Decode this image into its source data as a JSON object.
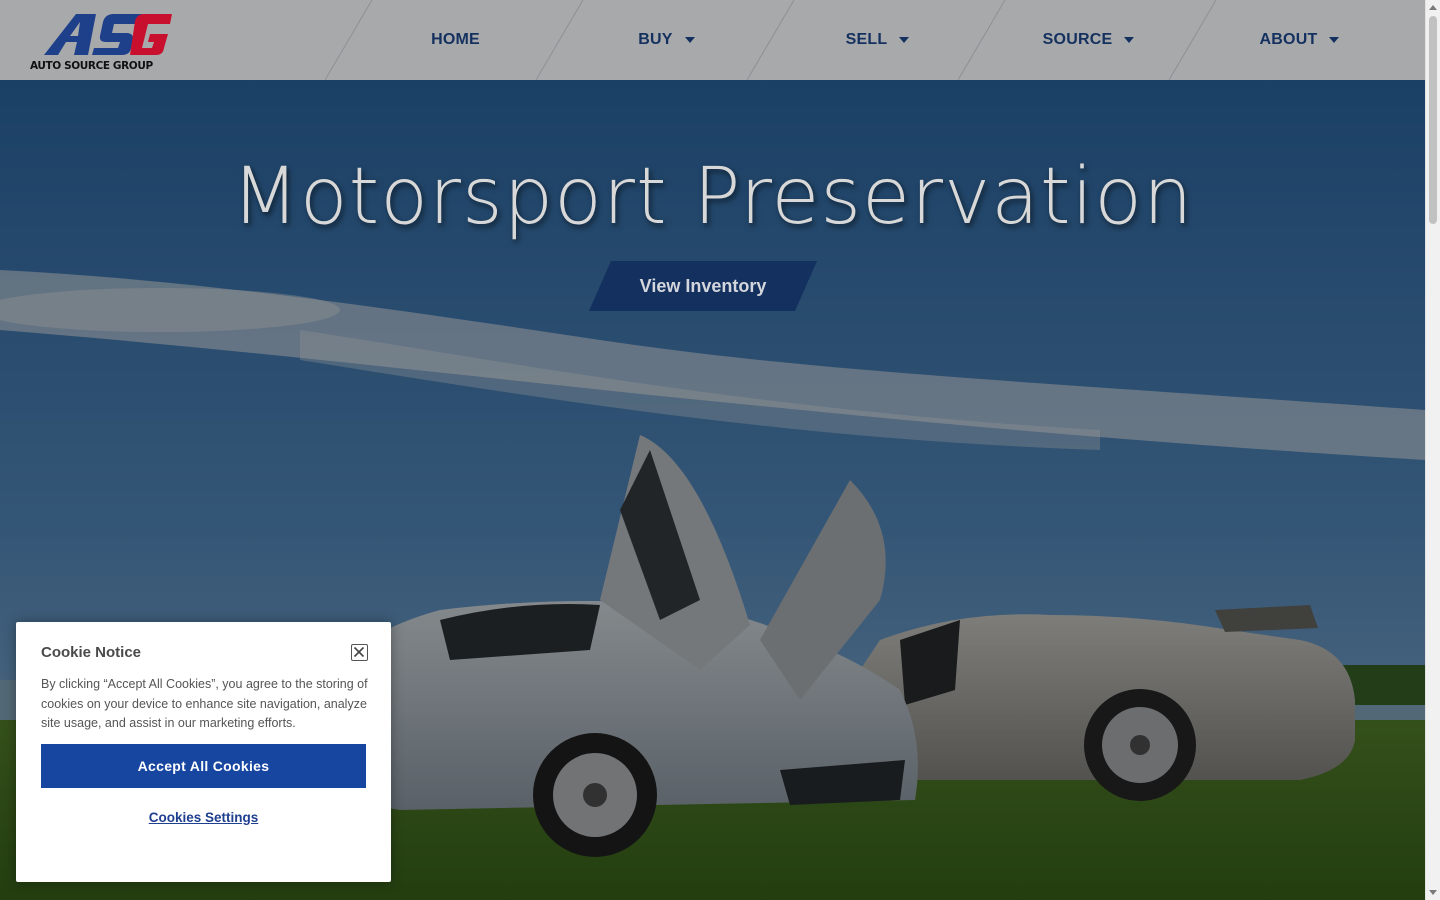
{
  "brand": {
    "logo_text": "AUTO SOURCE GROUP",
    "monogram": "ASG",
    "colors": {
      "primary": "#1e3f8a",
      "accent": "#c8102e",
      "nav_text": "#14305f"
    }
  },
  "nav": {
    "items": [
      {
        "label": "HOME",
        "has_dropdown": false
      },
      {
        "label": "BUY",
        "has_dropdown": true
      },
      {
        "label": "SELL",
        "has_dropdown": true
      },
      {
        "label": "SOURCE",
        "has_dropdown": true
      },
      {
        "label": "ABOUT",
        "has_dropdown": true
      }
    ]
  },
  "hero": {
    "title": "Motorsport Preservation",
    "cta_label": "View Inventory",
    "image_icon": "sports-cars-photo"
  },
  "cookie": {
    "title": "Cookie Notice",
    "body": "By clicking “Accept All Cookies”, you agree to the storing of cookies on your device to enhance site navigation, analyze site usage, and assist in our marketing efforts.",
    "accept_label": "Accept All Cookies",
    "settings_label": "Cookies Settings",
    "close_icon": "close-icon",
    "accept_color": "#1746a1"
  }
}
